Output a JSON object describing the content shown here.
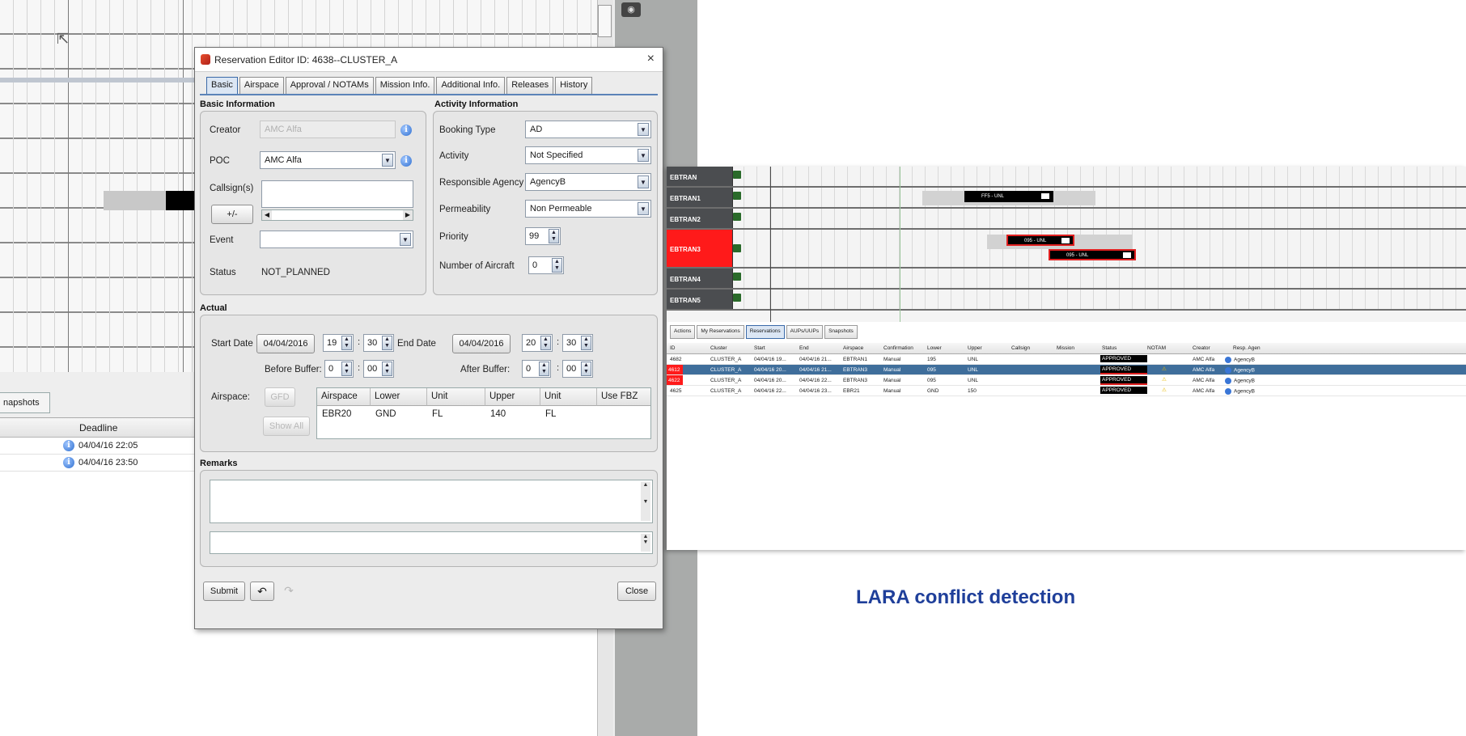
{
  "dialog": {
    "title": "Reservation Editor ID: 4638--CLUSTER_A",
    "close_glyph": "×",
    "tabs": [
      "Basic",
      "Airspace",
      "Approval / NOTAMs",
      "Mission Info.",
      "Additional Info.",
      "Releases",
      "History"
    ],
    "active_tab": "Basic",
    "basic": {
      "section_title": "Basic Information",
      "creator_label": "Creator",
      "creator_value": "AMC Alfa",
      "poc_label": "POC",
      "poc_value": "AMC Alfa",
      "callsigns_label": "Callsign(s)",
      "add_remove_label": "+/-",
      "event_label": "Event",
      "event_value": "",
      "status_label": "Status",
      "status_value": "NOT_PLANNED"
    },
    "activity": {
      "section_title": "Activity Information",
      "booking_type_label": "Booking Type",
      "booking_type_value": "AD",
      "activity_label": "Activity",
      "activity_value": "Not Specified",
      "responsible_agency_label": "Responsible Agency",
      "responsible_agency_value": "AgencyB",
      "permeability_label": "Permeability",
      "permeability_value": "Non Permeable",
      "priority_label": "Priority",
      "priority_value": "99",
      "num_aircraft_label": "Number of Aircraft",
      "num_aircraft_value": "0"
    },
    "actual": {
      "section_title": "Actual",
      "start_date_label": "Start Date",
      "start_date_value": "04/04/2016",
      "start_hour": "19",
      "start_minute": "30",
      "end_date_label": "End Date",
      "end_date_value": "04/04/2016",
      "end_hour": "20",
      "end_minute": "30",
      "before_buffer_label": "Before Buffer:",
      "before_buffer_h": "0",
      "before_buffer_m": "00",
      "after_buffer_label": "After Buffer:",
      "after_buffer_h": "0",
      "after_buffer_m": "00",
      "airspace_label": "Airspace:",
      "gfd_button": "GFD",
      "show_all_button": "Show All",
      "table_headers": [
        "Airspace",
        "Lower",
        "Unit",
        "Upper",
        "Unit",
        "Use FBZ"
      ],
      "table_row": [
        "EBR20",
        "GND",
        "FL",
        "140",
        "FL",
        ""
      ]
    },
    "remarks": {
      "section_title": "Remarks"
    },
    "footer": {
      "submit_label": "Submit",
      "undo_glyph": "↶",
      "redo_glyph": "↷",
      "close_label": "Close"
    }
  },
  "background": {
    "snapshot_tab": "napshots",
    "deadline_header": "Deadline",
    "deadlines": [
      "04/04/16 22:05",
      "04/04/16 23:50"
    ]
  },
  "lara": {
    "caption": "LARA conflict detection",
    "timeline_rows": [
      "EBTRAN",
      "EBTRAN1",
      "EBTRAN2",
      "EBTRAN3",
      "EBTRAN4",
      "EBTRAN5"
    ],
    "bars": [
      "FF5 - UNL",
      "095 - UNL",
      "095 - UNL"
    ],
    "tabs": [
      "Actions",
      "My Reservations",
      "Reservations",
      "AUPs/UUPs",
      "Snapshots"
    ],
    "active_tab": "Reservations",
    "headers": [
      "ID",
      "Cluster",
      "Start",
      "End",
      "Airspace",
      "Confirmation",
      "Lower",
      "Upper",
      "Callsign",
      "Mission",
      "Status",
      "NOTAM",
      "Creator",
      "Resp. Agen"
    ],
    "rows": [
      {
        "id": "4682",
        "cluster": "CLUSTER_A",
        "start": "04/04/16 19...",
        "end": "04/04/16 21...",
        "airspace": "EBTRAN1",
        "confirmation": "Manual",
        "lower": "195",
        "upper": "UNL",
        "status": "APPROVED",
        "notam": "",
        "creator": "AMC Alfa",
        "agency": "AgencyB"
      },
      {
        "id": "4612",
        "cluster": "CLUSTER_A",
        "start": "04/04/16 20...",
        "end": "04/04/16 21...",
        "airspace": "EBTRAN3",
        "confirmation": "Manual",
        "lower": "095",
        "upper": "UNL",
        "status": "APPROVED",
        "notam": "⚠",
        "creator": "AMC Alfa",
        "agency": "AgencyB"
      },
      {
        "id": "4622",
        "cluster": "CLUSTER_A",
        "start": "04/04/16 20...",
        "end": "04/04/16 22...",
        "airspace": "EBTRAN3",
        "confirmation": "Manual",
        "lower": "095",
        "upper": "UNL",
        "status": "APPROVED",
        "notam": "⚠",
        "creator": "AMC Alfa",
        "agency": "AgencyB"
      },
      {
        "id": "4625",
        "cluster": "CLUSTER_A",
        "start": "04/04/16 22...",
        "end": "04/04/16 23...",
        "airspace": "EBR21",
        "confirmation": "Manual",
        "lower": "GND",
        "upper": "150",
        "status": "APPROVED",
        "notam": "⚠",
        "creator": "AMC Alfa",
        "agency": "AgencyB"
      }
    ]
  },
  "colors": {
    "accent_blue": "#3f6e9b",
    "conflict_red": "#ff1a1a",
    "caption_blue": "#1f3f9a"
  }
}
